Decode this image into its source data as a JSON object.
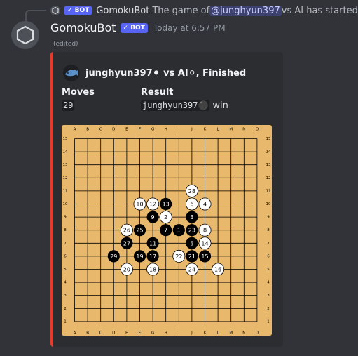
{
  "reply": {
    "bot_badge": "✓ BOT",
    "author": "GomokuBot",
    "text_before": "The game of ",
    "mention": "@junghyun397",
    "text_after": " vs AI has started"
  },
  "message": {
    "author": "GomokuBot",
    "bot_badge": "✓ BOT",
    "timestamp": "Today at 6:57 PM",
    "edited": "(edited)"
  },
  "embed": {
    "accent_color": "#e33c2a",
    "title": "junghyun397⚫ vs AI⚪, Finished",
    "moves_label": "Moves",
    "moves_value": "29",
    "result_label": "Result",
    "result_player": "junghyun397⚫",
    "result_suffix": "win"
  },
  "board": {
    "columns": [
      "A",
      "B",
      "C",
      "D",
      "E",
      "F",
      "G",
      "H",
      "I",
      "J",
      "K",
      "L",
      "M",
      "N",
      "O"
    ],
    "rows": [
      "15",
      "14",
      "13",
      "12",
      "11",
      "10",
      "9",
      "8",
      "7",
      "6",
      "5",
      "4",
      "3",
      "2",
      "1"
    ],
    "stones": [
      {
        "n": 1,
        "col": "I",
        "row": 8,
        "color": "black"
      },
      {
        "n": 2,
        "col": "H",
        "row": 9,
        "color": "white"
      },
      {
        "n": 3,
        "col": "J",
        "row": 9,
        "color": "black"
      },
      {
        "n": 4,
        "col": "K",
        "row": 10,
        "color": "white"
      },
      {
        "n": 5,
        "col": "J",
        "row": 7,
        "color": "black"
      },
      {
        "n": 6,
        "col": "J",
        "row": 10,
        "color": "white"
      },
      {
        "n": 7,
        "col": "H",
        "row": 8,
        "color": "black"
      },
      {
        "n": 8,
        "col": "K",
        "row": 8,
        "color": "white"
      },
      {
        "n": 9,
        "col": "G",
        "row": 9,
        "color": "black"
      },
      {
        "n": 10,
        "col": "F",
        "row": 10,
        "color": "white"
      },
      {
        "n": 11,
        "col": "G",
        "row": 7,
        "color": "black"
      },
      {
        "n": 12,
        "col": "G",
        "row": 10,
        "color": "white"
      },
      {
        "n": 13,
        "col": "H",
        "row": 10,
        "color": "black"
      },
      {
        "n": 14,
        "col": "K",
        "row": 7,
        "color": "white"
      },
      {
        "n": 15,
        "col": "K",
        "row": 6,
        "color": "black"
      },
      {
        "n": 16,
        "col": "L",
        "row": 5,
        "color": "white"
      },
      {
        "n": 17,
        "col": "G",
        "row": 6,
        "color": "black"
      },
      {
        "n": 18,
        "col": "G",
        "row": 5,
        "color": "white"
      },
      {
        "n": 19,
        "col": "F",
        "row": 6,
        "color": "black"
      },
      {
        "n": 20,
        "col": "E",
        "row": 5,
        "color": "white"
      },
      {
        "n": 21,
        "col": "J",
        "row": 6,
        "color": "black"
      },
      {
        "n": 22,
        "col": "I",
        "row": 6,
        "color": "white"
      },
      {
        "n": 23,
        "col": "J",
        "row": 8,
        "color": "black"
      },
      {
        "n": 24,
        "col": "J",
        "row": 5,
        "color": "white"
      },
      {
        "n": 25,
        "col": "F",
        "row": 8,
        "color": "black"
      },
      {
        "n": 26,
        "col": "E",
        "row": 8,
        "color": "white"
      },
      {
        "n": 27,
        "col": "E",
        "row": 7,
        "color": "black"
      },
      {
        "n": 28,
        "col": "J",
        "row": 11,
        "color": "white"
      },
      {
        "n": 29,
        "col": "D",
        "row": 6,
        "color": "black"
      }
    ],
    "board_color": "#e8b96c"
  }
}
